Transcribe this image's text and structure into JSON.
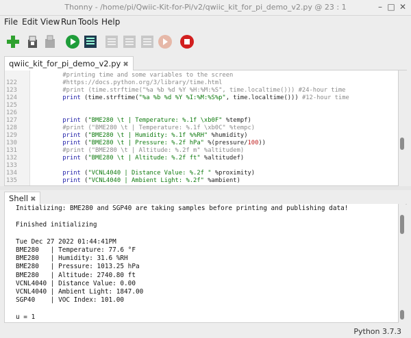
{
  "window": {
    "title": "Thonny  -  /home/pi/Qwiic-Kit-for-Pi/v2/qwiic_kit_for_pi_demo_v2.py  @  23 : 1"
  },
  "menu": [
    "File",
    "Edit",
    "View",
    "Run",
    "Tools",
    "Help"
  ],
  "toolbar": {
    "icons": [
      "new-file-icon",
      "open-file-icon",
      "save-file-icon",
      "run-icon",
      "debug-icon",
      "step-over-icon",
      "step-into-icon",
      "step-out-icon",
      "resume-icon",
      "stop-icon"
    ]
  },
  "editor": {
    "tab_label": "qwiic_kit_for_pi_demo_v2.py",
    "tab_close": "✖",
    "lines": [
      {
        "num": "",
        "segs": [
          [
            "        #printing time and some variables to the screen",
            "#8a8a8a"
          ]
        ]
      },
      {
        "num": "122",
        "segs": [
          [
            "        #https://docs.python.org/3/library/time.html",
            "#8a8a8a"
          ]
        ]
      },
      {
        "num": "123",
        "segs": [
          [
            "        #print (time.strftime(\"%a %b %d %Y %H:%M:%S\", time.localtime())) #24-hour time",
            "#8a8a8a"
          ]
        ]
      },
      {
        "num": "124",
        "segs": [
          [
            "        print",
            "#1a1aa6"
          ],
          [
            " (time.strftime(",
            "#222"
          ],
          [
            "\"%a %b %d %Y %I:%M:%S%p\"",
            "#0e7a0e"
          ],
          [
            ", time.localtime())) ",
            "#222"
          ],
          [
            "#12-hour time",
            "#8a8a8a"
          ]
        ]
      },
      {
        "num": "125",
        "segs": [
          [
            "",
            "#222"
          ]
        ]
      },
      {
        "num": "126",
        "segs": [
          [
            "",
            "#222"
          ]
        ]
      },
      {
        "num": "127",
        "segs": [
          [
            "        print",
            "#1a1aa6"
          ],
          [
            " (",
            "#222"
          ],
          [
            "\"BME280 \\t | Temperature: %.1f \\xb0F\"",
            "#0e7a0e"
          ],
          [
            " %tempf)",
            "#222"
          ]
        ]
      },
      {
        "num": "128",
        "segs": [
          [
            "        #print (\"BME280 \\t | Temperature: %.1f \\xb0C\" %tempc)",
            "#8a8a8a"
          ]
        ]
      },
      {
        "num": "129",
        "segs": [
          [
            "        print",
            "#1a1aa6"
          ],
          [
            " (",
            "#222"
          ],
          [
            "\"BME280 \\t | Humidity: %.1f %%RH\"",
            "#0e7a0e"
          ],
          [
            " %humidity)",
            "#222"
          ]
        ]
      },
      {
        "num": "130",
        "segs": [
          [
            "        print",
            "#1a1aa6"
          ],
          [
            " (",
            "#222"
          ],
          [
            "\"BME280 \\t | Pressure: %.2f hPa\"",
            "#0e7a0e"
          ],
          [
            " %(pressure/",
            "#222"
          ],
          [
            "100",
            "#c01c1c"
          ],
          [
            "))",
            "#222"
          ]
        ]
      },
      {
        "num": "131",
        "segs": [
          [
            "        #print (\"BME280 \\t | Altitude: %.2f m\" %altitudem)",
            "#8a8a8a"
          ]
        ]
      },
      {
        "num": "132",
        "segs": [
          [
            "        print",
            "#1a1aa6"
          ],
          [
            " (",
            "#222"
          ],
          [
            "\"BME280 \\t | Altitude: %.2f ft\"",
            "#0e7a0e"
          ],
          [
            " %altitudef)",
            "#222"
          ]
        ]
      },
      {
        "num": "133",
        "segs": [
          [
            "",
            "#222"
          ]
        ]
      },
      {
        "num": "134",
        "segs": [
          [
            "        print",
            "#1a1aa6"
          ],
          [
            " (",
            "#222"
          ],
          [
            "\"VCNL4040 | Distance Value: %.2f \"",
            "#0e7a0e"
          ],
          [
            " %proximity)",
            "#222"
          ]
        ]
      },
      {
        "num": "135",
        "segs": [
          [
            "        print",
            "#1a1aa6"
          ],
          [
            " (",
            "#222"
          ],
          [
            "\"VCNL4040 | Ambient Light: %.2f\"",
            "#0e7a0e"
          ],
          [
            " %ambient)",
            "#222"
          ]
        ]
      }
    ]
  },
  "shell": {
    "tab_label": "Shell",
    "tab_close": "✖",
    "lines": [
      "Initializing: BME280 and SGP40 are taking samples before printing and publishing data!",
      "",
      "Finished initializing",
      "",
      "Tue Dec 27 2022 01:44:41PM",
      "BME280   | Temperature: 77.6 °F",
      "BME280   | Humidity: 31.6 %RH",
      "BME280   | Pressure: 1013.25 hPa",
      "BME280   | Altitude: 2740.80 ft",
      "VCNL4040 | Distance Value: 0.00",
      "VCNL4040 | Ambient Light: 1847.00",
      "SGP40    | VOC Index: 101.00",
      "",
      "u = 1"
    ]
  },
  "status": {
    "text": "Python 3.7.3"
  }
}
